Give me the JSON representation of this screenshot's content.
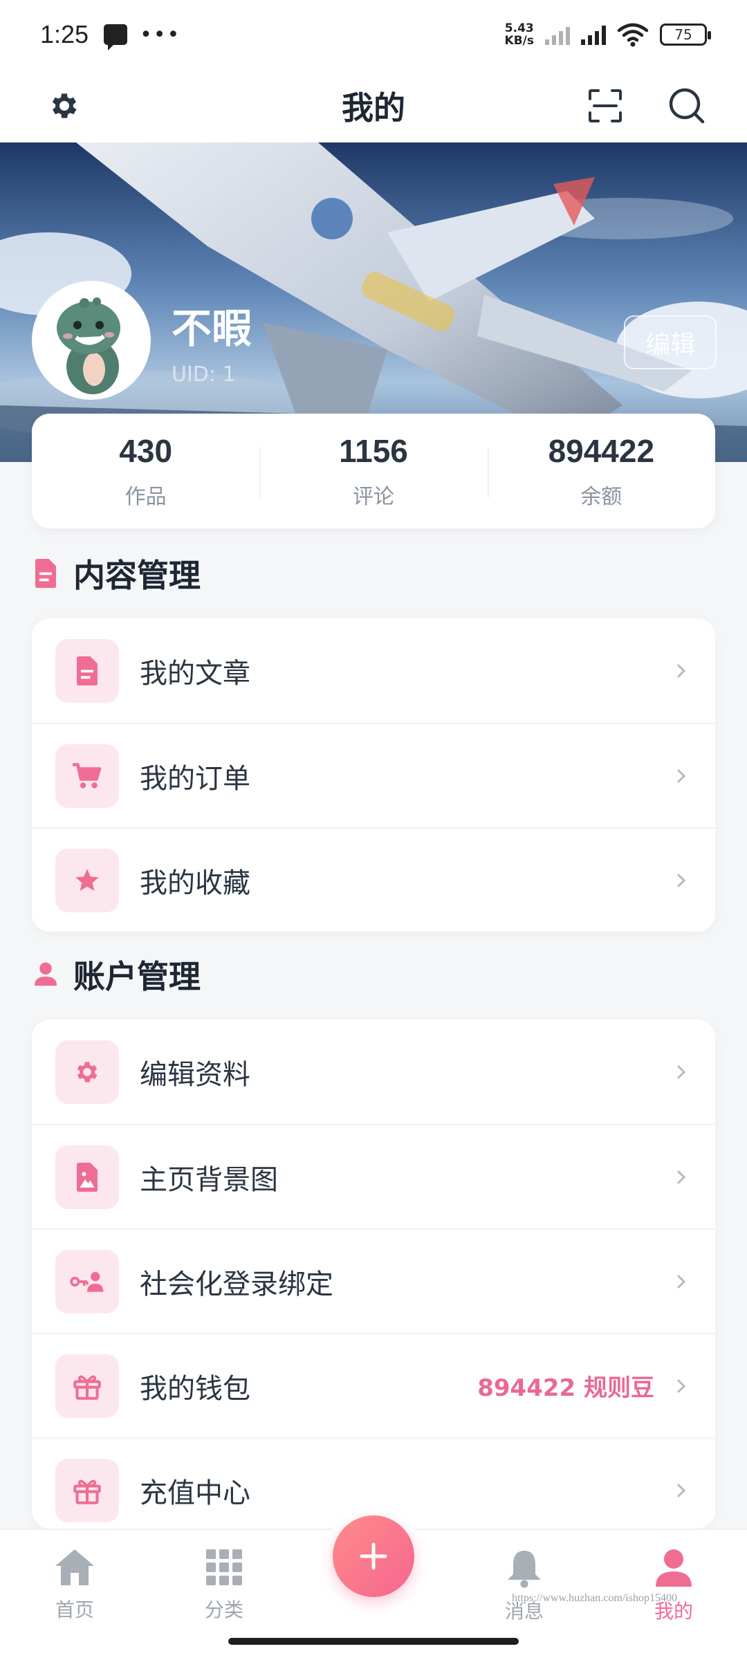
{
  "status_bar": {
    "time": "1:25",
    "dots": "•••",
    "speed_value": "5.43",
    "speed_unit": "KB/s",
    "battery": "75"
  },
  "header": {
    "title": "我的"
  },
  "profile": {
    "name": "不暇",
    "uid": "UID: 1",
    "edit_label": "编辑"
  },
  "stats": [
    {
      "value": "430",
      "label": "作品"
    },
    {
      "value": "1156",
      "label": "评论"
    },
    {
      "value": "894422",
      "label": "余额"
    }
  ],
  "content_section": {
    "title": "内容管理",
    "items": [
      {
        "label": "我的文章",
        "icon": "document-icon"
      },
      {
        "label": "我的订单",
        "icon": "cart-icon"
      },
      {
        "label": "我的收藏",
        "icon": "star-icon"
      }
    ]
  },
  "account_section": {
    "title": "账户管理",
    "items": [
      {
        "label": "编辑资料",
        "icon": "gear-icon"
      },
      {
        "label": "主页背景图",
        "icon": "image-icon"
      },
      {
        "label": "社会化登录绑定",
        "icon": "key-user-icon"
      },
      {
        "label": "我的钱包",
        "icon": "gift-icon",
        "extra": "894422 规则豆"
      },
      {
        "label": "充值中心",
        "icon": "gift-icon"
      }
    ]
  },
  "bottom_nav": {
    "items": [
      {
        "label": "首页",
        "icon": "home-icon"
      },
      {
        "label": "分类",
        "icon": "grid-icon"
      },
      {
        "label": "消息",
        "icon": "bell-icon"
      },
      {
        "label": "我的",
        "icon": "user-icon",
        "active": true
      }
    ],
    "fab_icon": "plus-icon"
  },
  "watermark": "https://www.huzhan.com/ishop15400",
  "colors": {
    "accent": "#ef6d93",
    "accent_light": "#fde7ee",
    "background": "#f5f6f8",
    "text": "#2b3542"
  }
}
